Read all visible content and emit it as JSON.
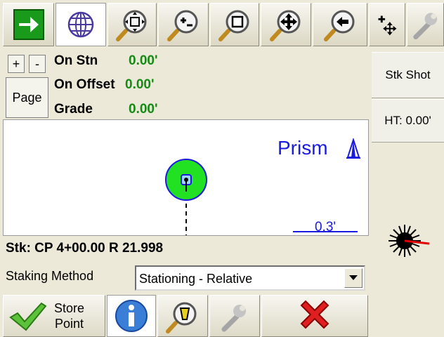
{
  "toolbar": {
    "icons": [
      "go-arrow-icon",
      "globe-icon",
      "zoom-extents-icon",
      "zoom-in-out-icon",
      "zoom-window-icon",
      "pan-icon",
      "zoom-previous-icon",
      "add-point-icon",
      "wrench-icon"
    ]
  },
  "info": {
    "plus_label": "+",
    "minus_label": "-",
    "page_label": "Page",
    "on_stn_label": "On Stn",
    "on_stn_value": "0.00'",
    "on_offset_label": "On Offset",
    "on_offset_value": "0.00'",
    "grade_label": "Grade",
    "grade_value": "0.00'"
  },
  "right": {
    "stk_shot_label": "Stk Shot",
    "ht_label": "HT: 0.00'"
  },
  "map": {
    "prism_label": "Prism",
    "scale_label": "0.3'",
    "target_color": "#22e022"
  },
  "status": {
    "stake_text": "Stk: CP 4+00.00 R 21.998",
    "method_label": "Staking Method",
    "method_value": "Stationing - Relative"
  },
  "bottom": {
    "store_line1": "Store",
    "store_line2": "Point"
  }
}
